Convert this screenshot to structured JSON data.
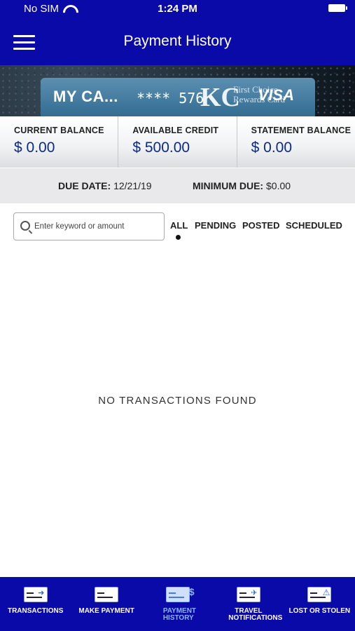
{
  "status": {
    "carrier": "No SIM",
    "time": "1:24 PM"
  },
  "header": {
    "title": "Payment History"
  },
  "card": {
    "nickname": "MY CA...",
    "masked_number": "**** 576",
    "logo": "KC",
    "brand_line1": "First Choice",
    "brand_line2": "Rewards Card",
    "network": "VISA"
  },
  "balances": [
    {
      "label": "CURRENT BALANCE",
      "value": "$ 0.00"
    },
    {
      "label": "AVAILABLE CREDIT",
      "value": "$ 500.00"
    },
    {
      "label": "STATEMENT BALANCE",
      "value": "$ 0.00"
    }
  ],
  "due": {
    "date_label": "DUE DATE:",
    "date_value": "12/21/19",
    "min_label": "MINIMUM DUE:",
    "min_value": "$0.00"
  },
  "search": {
    "placeholder": "Enter keyword or amount"
  },
  "filters": {
    "all": "ALL",
    "pending": "PENDING",
    "posted": "POSTED",
    "scheduled": "SCHEDULED",
    "active": "ALL"
  },
  "empty_message": "NO TRANSACTIONS FOUND",
  "tabbar": {
    "items": [
      {
        "label": "TRANSACTIONS",
        "icon": "card-transfer-icon"
      },
      {
        "label": "MAKE PAYMENT",
        "icon": "card-icon"
      },
      {
        "label": "PAYMENT HISTORY",
        "icon": "payment-history-icon"
      },
      {
        "label": "TRAVEL NOTIFICATIONS",
        "icon": "travel-card-icon"
      },
      {
        "label": "LOST OR STOLEN",
        "icon": "card-warning-icon"
      }
    ],
    "active_index": 2
  },
  "colors": {
    "brand_blue": "#0a0aa8",
    "balance_text": "#0a2a8a",
    "active_tab": "#8fb4ff"
  }
}
